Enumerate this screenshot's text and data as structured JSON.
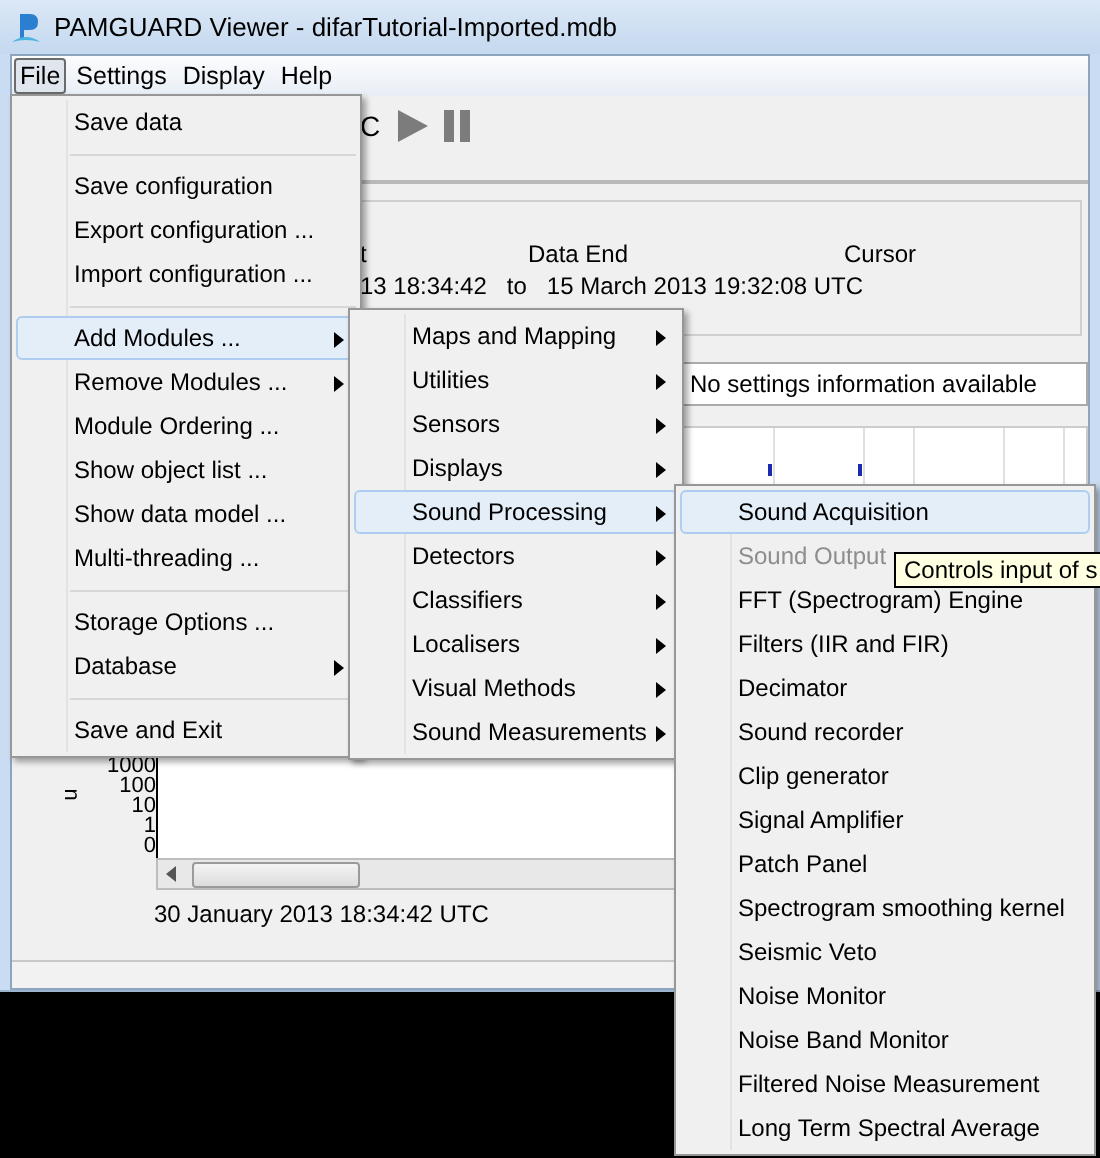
{
  "window": {
    "title": "PAMGUARD Viewer - difarTutorial-Imported.mdb"
  },
  "menu_bar": [
    {
      "label": "File",
      "selected": true
    },
    {
      "label": "Settings",
      "selected": false
    },
    {
      "label": "Display",
      "selected": false
    },
    {
      "label": "Help",
      "selected": false
    }
  ],
  "toolbar": {
    "label": "C"
  },
  "data_range": {
    "column_1": "t",
    "data_end_label": "Data End",
    "cursor_label": "Cursor",
    "range_start": "13 18:34:42",
    "range_to": "to",
    "range_end": "15 March 2013 19:32:08 UTC"
  },
  "settings_info": "No settings information available",
  "chart": {
    "ylabel": "n",
    "yticks": [
      "1000",
      "100",
      "10",
      "1",
      "0"
    ],
    "start_time": "30 January 2013 18:34:42 UTC"
  },
  "file_menu": [
    {
      "kind": "item",
      "label": "Save data",
      "selected": false,
      "submenu": false
    },
    {
      "kind": "separator"
    },
    {
      "kind": "item",
      "label": "Save configuration",
      "selected": false,
      "submenu": false
    },
    {
      "kind": "item",
      "label": "Export configuration  ...",
      "selected": false,
      "submenu": false
    },
    {
      "kind": "item",
      "label": "Import configuration ...",
      "selected": false,
      "submenu": false
    },
    {
      "kind": "separator"
    },
    {
      "kind": "item",
      "label": "Add Modules ...",
      "selected": true,
      "submenu": true
    },
    {
      "kind": "item",
      "label": "Remove Modules ...",
      "selected": false,
      "submenu": true
    },
    {
      "kind": "item",
      "label": "Module Ordering ...",
      "selected": false,
      "submenu": false
    },
    {
      "kind": "item",
      "label": "Show object list ...",
      "selected": false,
      "submenu": false
    },
    {
      "kind": "item",
      "label": "Show data model ...",
      "selected": false,
      "submenu": false
    },
    {
      "kind": "item",
      "label": "Multi-threading ...",
      "selected": false,
      "submenu": false
    },
    {
      "kind": "separator"
    },
    {
      "kind": "item",
      "label": "Storage Options ...",
      "selected": false,
      "submenu": false
    },
    {
      "kind": "item",
      "label": "Database",
      "selected": false,
      "submenu": true
    },
    {
      "kind": "separator"
    },
    {
      "kind": "item",
      "label": "Save and Exit",
      "selected": false,
      "submenu": false
    }
  ],
  "modules_menu": [
    {
      "label": "Maps and Mapping",
      "selected": false
    },
    {
      "label": "Utilities",
      "selected": false
    },
    {
      "label": "Sensors",
      "selected": false
    },
    {
      "label": "Displays",
      "selected": false
    },
    {
      "label": "Sound Processing",
      "selected": true
    },
    {
      "label": "Detectors",
      "selected": false
    },
    {
      "label": "Classifiers",
      "selected": false
    },
    {
      "label": "Localisers",
      "selected": false
    },
    {
      "label": "Visual Methods",
      "selected": false
    },
    {
      "label": "Sound Measurements",
      "selected": false
    }
  ],
  "sound_processing_menu": [
    {
      "label": "Sound Acquisition",
      "selected": true,
      "disabled": false
    },
    {
      "label": "Sound Output",
      "selected": false,
      "disabled": true
    },
    {
      "label": "FFT (Spectrogram) Engine",
      "selected": false,
      "disabled": false
    },
    {
      "label": "Filters (IIR and FIR)",
      "selected": false,
      "disabled": false
    },
    {
      "label": "Decimator",
      "selected": false,
      "disabled": false
    },
    {
      "label": "Sound recorder",
      "selected": false,
      "disabled": false
    },
    {
      "label": "Clip generator",
      "selected": false,
      "disabled": false
    },
    {
      "label": "Signal Amplifier",
      "selected": false,
      "disabled": false
    },
    {
      "label": "Patch Panel",
      "selected": false,
      "disabled": false
    },
    {
      "label": "Spectrogram smoothing kernel",
      "selected": false,
      "disabled": false
    },
    {
      "label": "Seismic Veto",
      "selected": false,
      "disabled": false
    },
    {
      "label": "Noise Monitor",
      "selected": false,
      "disabled": false
    },
    {
      "label": "Noise Band Monitor",
      "selected": false,
      "disabled": false
    },
    {
      "label": "Filtered Noise Measurement",
      "selected": false,
      "disabled": false
    },
    {
      "label": "Long Term Spectral Average",
      "selected": false,
      "disabled": false
    }
  ],
  "tooltip": "Controls input of s"
}
